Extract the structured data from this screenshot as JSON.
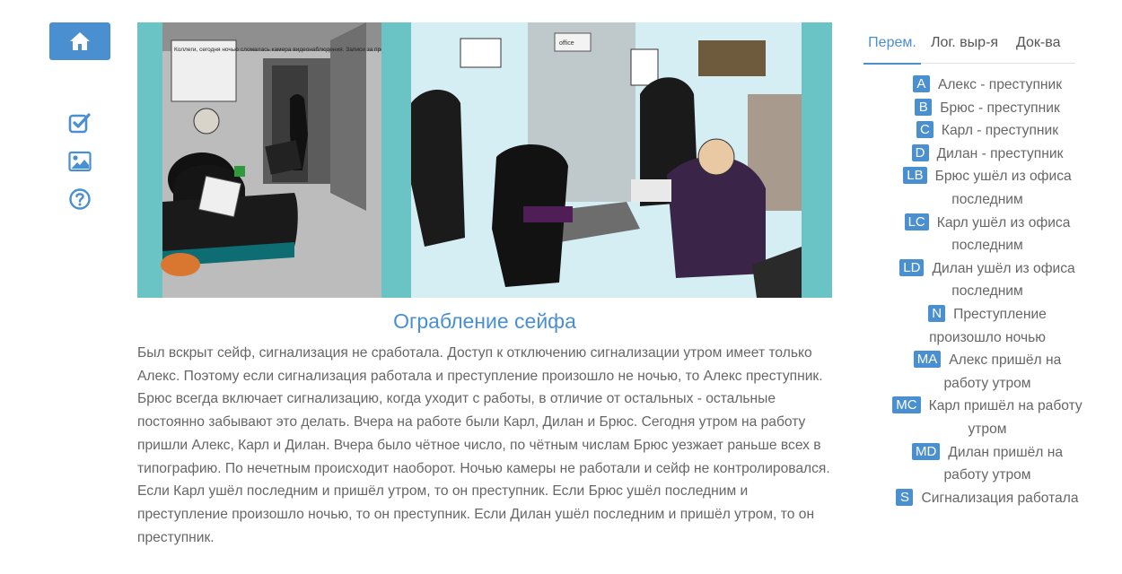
{
  "nav": {
    "home_icon": "home-icon",
    "icons": [
      "check-square-icon",
      "image-icon",
      "question-circle-icon"
    ],
    "accent": "#4a8fd0"
  },
  "illustration": {
    "note_text": "Коллеги, сегодня ночью сломалась камера видеонаблюдения. Записи за прошедшую ночь не пострадали.",
    "sign_text": "office"
  },
  "story": {
    "title": "Ограбление сейфа",
    "text": "Был вскрыт сейф, сигнализация не сработала. Доступ к отключению сигнализации утром имеет только Алекс. Поэтому если сигнализация работала и преступление произошло не ночью, то Алекс преступник. Брюс всегда включает сигнализацию, когда уходит с работы, в отличие от остальных - остальные постоянно забывают это делать. Вчера на работе были Карл, Дилан и Брюс. Сегодня утром на работу пришли Алекс, Карл и Дилан. Вчера было чётное число, по чётным числам Брюс уезжает раньше всех в типографию. По нечетным происходит наоборот. Ночью камеры не работали и сейф не контролировался. Если Карл ушёл последним и пришёл утром, то он преступник. Если Брюс ушёл последним и преступление произошло ночью, то он преступник. Если Дилан ушёл последним и пришёл утром, то он преступник."
  },
  "tabs": [
    {
      "label": "Перем.",
      "active": true
    },
    {
      "label": "Лог. выр-я",
      "active": false
    },
    {
      "label": "Док-ва",
      "active": false
    }
  ],
  "variables": [
    {
      "badge": "A",
      "line1": "Алекс - преступник",
      "line2": ""
    },
    {
      "badge": "B",
      "line1": "Брюс - преступник",
      "line2": ""
    },
    {
      "badge": "C",
      "line1": "Карл - преступник",
      "line2": ""
    },
    {
      "badge": "D",
      "line1": "Дилан - преступник",
      "line2": ""
    },
    {
      "badge": "LB",
      "line1": "Брюс ушёл из офиса",
      "line2": "последним"
    },
    {
      "badge": "LC",
      "line1": "Карл ушёл из офиса",
      "line2": "последним"
    },
    {
      "badge": "LD",
      "line1": "Дилан ушёл из офиса",
      "line2": "последним"
    },
    {
      "badge": "N",
      "line1": "Преступление",
      "line2": "произошло ночью"
    },
    {
      "badge": "MA",
      "line1": "Алекс пришёл на",
      "line2": "работу утром"
    },
    {
      "badge": "MC",
      "line1": "Карл пришёл на работу",
      "line2": "утром"
    },
    {
      "badge": "MD",
      "line1": "Дилан пришёл на",
      "line2": "работу утром"
    },
    {
      "badge": "S",
      "line1": "Сигнализация работала",
      "line2": ""
    }
  ]
}
